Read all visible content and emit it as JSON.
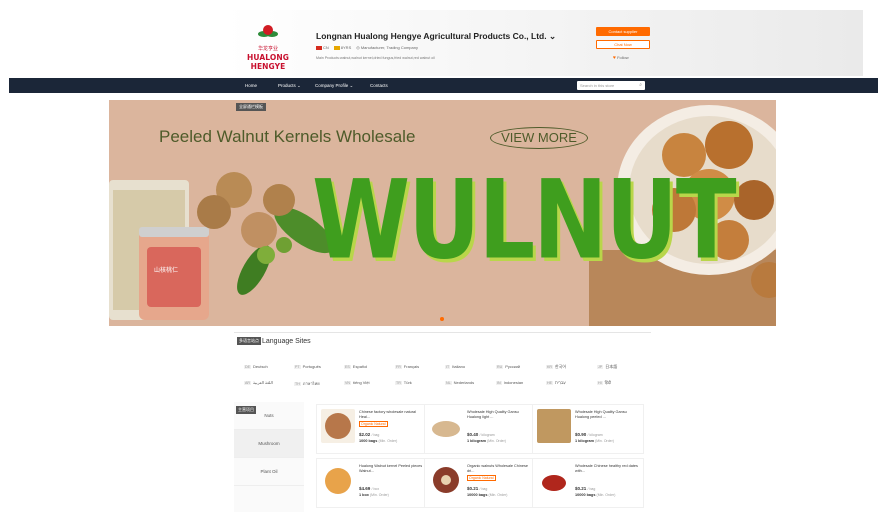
{
  "header": {
    "logo_cn": "华龙亨业",
    "logo_text": "HUALONG HENGYE",
    "company_name": "Longnan Hualong Hengye Agricultural Products Co., Ltd.",
    "company_name_chevron": "⌄",
    "country": "CN",
    "years": "8YRS",
    "business_type": "Manufacturer, Trading Company",
    "main_products": "Main Products:walnut,walnut kernel,dried fungus,fried walnut,red walnut oil",
    "contact_button": "Contact supplier",
    "chat_button": "Chat Now",
    "follow_label": "Follow"
  },
  "nav": {
    "items": [
      "Home",
      "Products ⌄",
      "Company Profile ⌄",
      "Contacts"
    ],
    "search_placeholder": "Search in this store"
  },
  "banner": {
    "tag": "全屏通栏模板",
    "headline": "Peeled Walnut  Kernels Wholesale",
    "view_more": "VIEW MORE",
    "big_text": "WULNUT",
    "jar_label": "山核桃仁"
  },
  "languages": {
    "badge": "多语言站点",
    "title": "Language Sites",
    "items": [
      {
        "code": "DE",
        "name": "Deutsch"
      },
      {
        "code": "PT",
        "name": "Português"
      },
      {
        "code": "ES",
        "name": "Español"
      },
      {
        "code": "FR",
        "name": "Français"
      },
      {
        "code": "IT",
        "name": "Italiano"
      },
      {
        "code": "RU",
        "name": "Русский"
      },
      {
        "code": "KR",
        "name": "한국어"
      },
      {
        "code": "JP",
        "name": "日本語"
      },
      {
        "code": "AR",
        "name": "اللغة العربية"
      },
      {
        "code": "TH",
        "name": "ภาษาไทย"
      },
      {
        "code": "VN",
        "name": "tiếng Việt"
      },
      {
        "code": "TR",
        "name": "Türk"
      },
      {
        "code": "NL",
        "name": "Nederlands"
      },
      {
        "code": "IN",
        "name": "Indonesian"
      },
      {
        "code": "HE",
        "name": "עִברִית"
      },
      {
        "code": "HI",
        "name": "हिंदी"
      }
    ]
  },
  "products": {
    "section_badge": "主营项目",
    "categories": [
      "Nuts",
      "Mushroom",
      "Plant Oil"
    ],
    "items": [
      {
        "title": "Chinese factory wholesale natural Heal...",
        "tag": "Organic Natural",
        "price": "$2.02",
        "unit": "/ bag",
        "moq": "1000 bags",
        "moq_unit": "(Min. Order)",
        "color": "#b7774a"
      },
      {
        "title": "Wholesale High Quality Gansu Hualong light ...",
        "tag": "",
        "price": "$0.40",
        "unit": "/ kilogram",
        "moq": "1 kilogram",
        "moq_unit": "(Min. Order)",
        "color": "#d7b890"
      },
      {
        "title": "Wholesale High Quality Gansu Hualong peeled ...",
        "tag": "",
        "price": "$0.90",
        "unit": "/ kilogram",
        "moq": "1 kilogram",
        "moq_unit": "(Min. Order)",
        "color": "#c09860"
      },
      {
        "title": "Hualong Walnut kernel Peeled pieces Walnut...",
        "tag": "",
        "price": "$4.69",
        "unit": "/ box",
        "moq": "1 box",
        "moq_unit": "(Min. Order)",
        "color": "#e8a34a"
      },
      {
        "title": "Organic walnuts Wholesale Chinese dri...",
        "tag": "Organic Natural",
        "price": "$0.21",
        "unit": "/ bag",
        "moq": "10000 bags",
        "moq_unit": "(Min. Order)",
        "color": "#8a3c2a"
      },
      {
        "title": "Wholesale Chinese healthy red dates with...",
        "tag": "",
        "price": "$0.21",
        "unit": "/ bag",
        "moq": "10000 bags",
        "moq_unit": "(Min. Order)",
        "color": "#b0261c"
      }
    ]
  }
}
